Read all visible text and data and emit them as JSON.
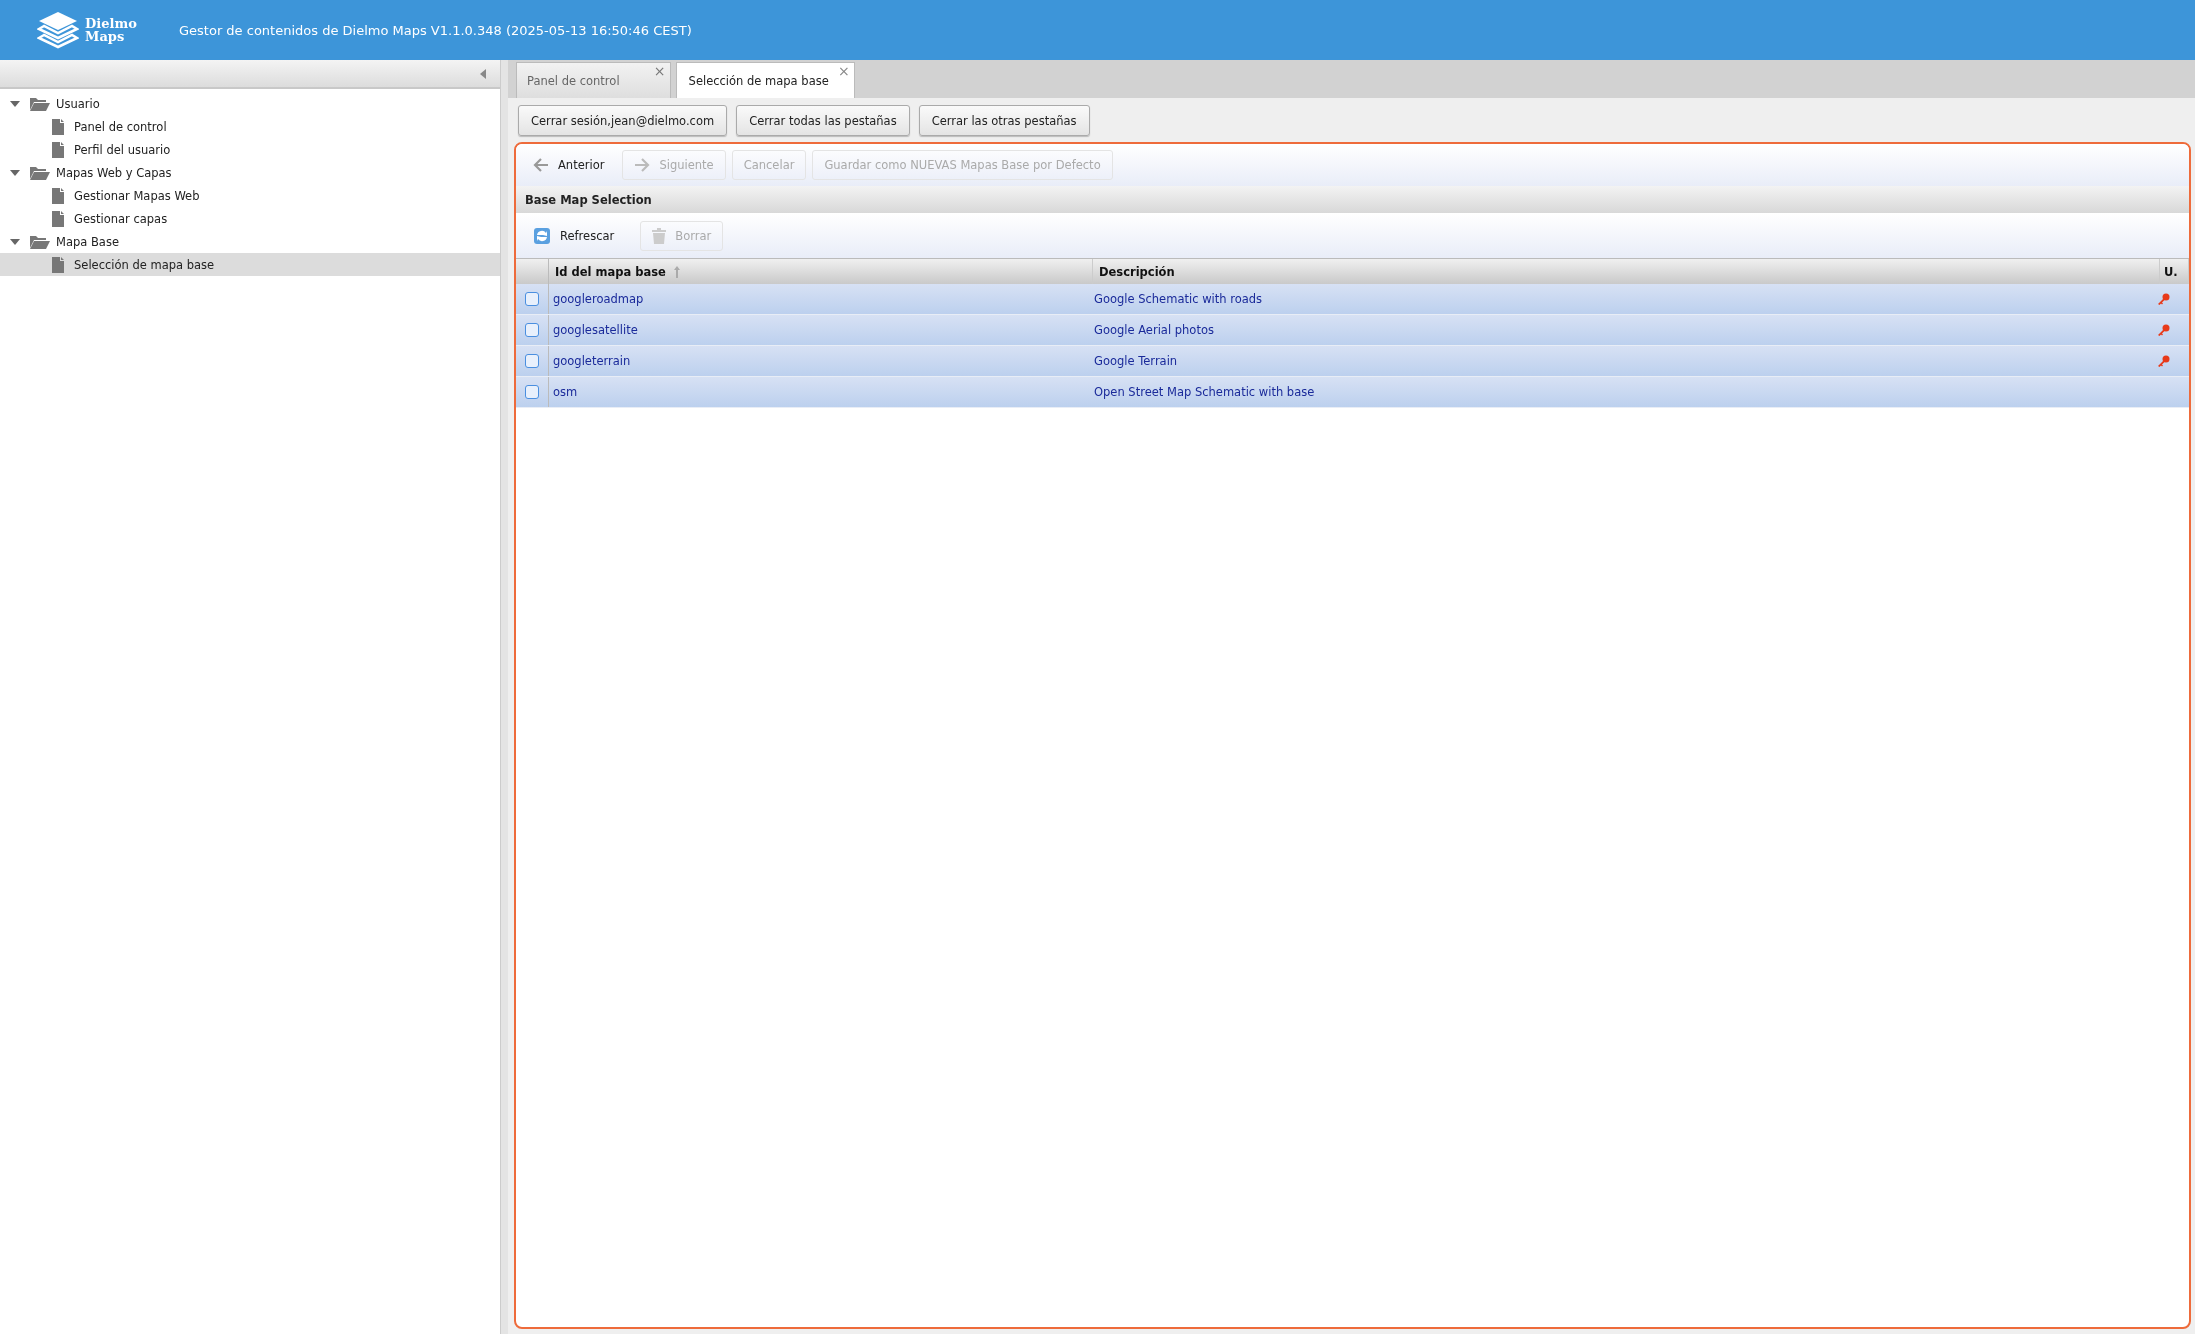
{
  "header": {
    "logo_text": "Dielmo\nMaps",
    "title": "Gestor de contenidos de Dielmo Maps V1.1.0.348 (2025-05-13 16:50:46 CEST)"
  },
  "sidebar": {
    "tree": [
      {
        "label": "Usuario",
        "expanded": true,
        "selected": false,
        "children": [
          {
            "label": "Panel de control",
            "selected": false
          },
          {
            "label": "Perfil del usuario",
            "selected": false
          }
        ]
      },
      {
        "label": "Mapas Web y Capas",
        "expanded": true,
        "selected": false,
        "children": [
          {
            "label": "Gestionar Mapas Web",
            "selected": false
          },
          {
            "label": "Gestionar capas",
            "selected": false
          }
        ]
      },
      {
        "label": "Mapa Base",
        "expanded": true,
        "selected": false,
        "children": [
          {
            "label": "Selección de mapa base",
            "selected": true
          }
        ]
      }
    ]
  },
  "tabs": [
    {
      "label": "Panel de control",
      "selected": false,
      "close": "×"
    },
    {
      "label": "Selección de mapa base",
      "selected": true,
      "close": "×"
    }
  ],
  "session_buttons": [
    "Cerrar sesión,jean@dielmo.com",
    "Cerrar todas las pestañas",
    "Cerrar las otras pestañas"
  ],
  "wizard_toolbar": [
    {
      "label": "Anterior",
      "kind": "back",
      "disabled": false
    },
    {
      "label": "Siguiente",
      "kind": "next",
      "disabled": true
    },
    {
      "label": "Cancelar",
      "kind": "plain",
      "disabled": true
    },
    {
      "label": "Guardar como NUEVAS Mapas Base por Defecto",
      "kind": "plain",
      "disabled": true
    }
  ],
  "panel": {
    "title": "Base Map Selection",
    "toolbar": [
      {
        "label": "Refrescar",
        "kind": "refresh",
        "disabled": false
      },
      {
        "label": "Borrar",
        "kind": "delete",
        "disabled": true
      }
    ],
    "table": {
      "columns": [
        {
          "label": "Id del mapa base",
          "sorted": true
        },
        {
          "label": "Descripción",
          "sorted": false
        },
        {
          "label": "U.",
          "sorted": false
        }
      ],
      "rows": [
        {
          "checked": false,
          "id": "googleroadmap",
          "description": "Google Schematic with roads",
          "key": true
        },
        {
          "checked": false,
          "id": "googlesatellite",
          "description": "Google Aerial photos",
          "key": true
        },
        {
          "checked": false,
          "id": "googleterrain",
          "description": "Google Terrain",
          "key": true
        },
        {
          "checked": false,
          "id": "osm",
          "description": "Open Street Map Schematic with base",
          "key": false
        }
      ]
    }
  }
}
